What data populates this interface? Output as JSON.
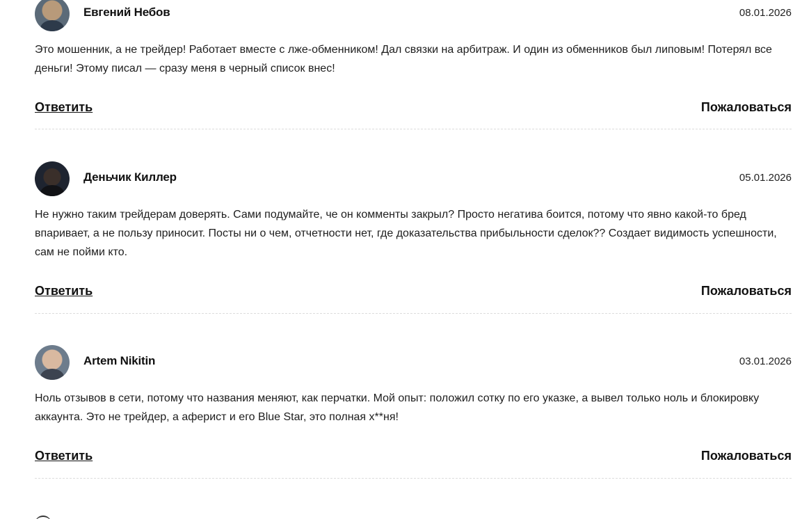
{
  "comments": [
    {
      "author": "Евгений Небов",
      "date": "08.01.2026",
      "text": "Это мошенник, а не трейдер! Работает вместе с лже-обменником! Дал связки на арбитраж. И один из обменников был липовым! Потерял все деньги! Этому писал — сразу меня в черный список внес!",
      "reply_label": "Ответить",
      "report_label": "Пожаловаться"
    },
    {
      "author": "Деньчик Киллер",
      "date": "05.01.2026",
      "text": "Не нужно таким трейдерам доверять. Сами подумайте, че он комменты закрыл? Просто негатива боится, потому что явно какой-то бред впаривает, а не пользу приносит. Посты ни о чем, отчетности нет, где доказательства прибыльности сделок?? Создает видимость успешности, сам не пойми кто.",
      "reply_label": "Ответить",
      "report_label": "Пожаловаться"
    },
    {
      "author": "Artem Nikitin",
      "date": "03.01.2026",
      "text": "Ноль отзывов в сети, потому что названия меняют, как перчатки. Мой опыт: положил сотку по его указке, а вывел только ноль и блокировку аккаунта. Это не трейдер, а аферист и его Blue Star, это полная х**ня!",
      "reply_label": "Ответить",
      "report_label": "Пожаловаться"
    }
  ]
}
